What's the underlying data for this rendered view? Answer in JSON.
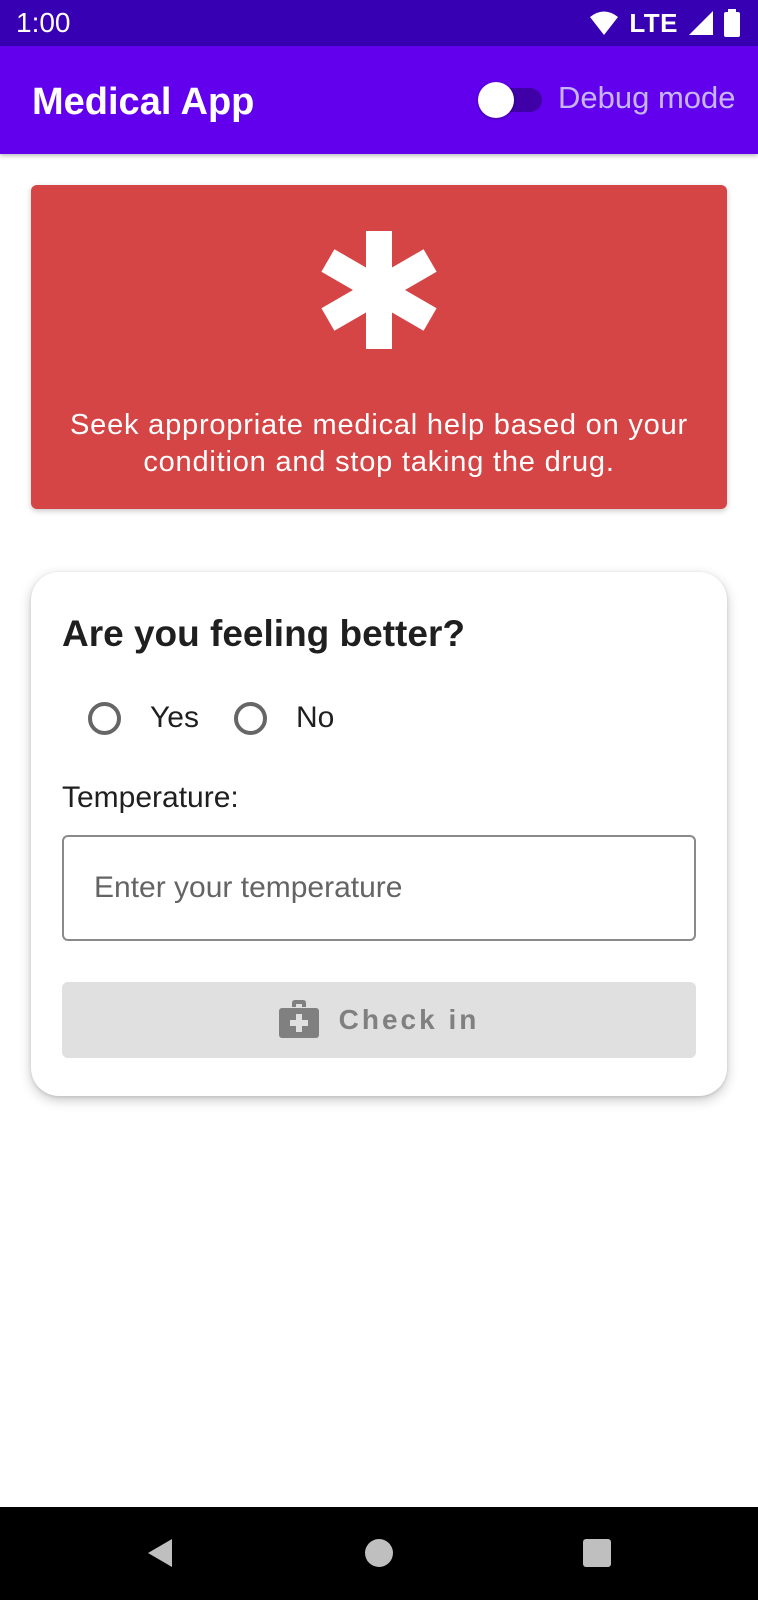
{
  "status_bar": {
    "time": "1:00",
    "network": "LTE",
    "icons": [
      "wifi-icon",
      "cell-signal-icon",
      "battery-icon"
    ]
  },
  "app_bar": {
    "title": "Medical App",
    "debug_toggle": {
      "label": "Debug mode",
      "checked": false
    },
    "color": "#6200ee"
  },
  "warning": {
    "icon": "asterisk-medical-icon",
    "message": "Seek appropriate medical help based on your condition and stop taking the drug.",
    "color": "#d64545"
  },
  "checkin": {
    "question": "Are you feeling better?",
    "options": [
      {
        "label": "Yes",
        "selected": false
      },
      {
        "label": "No",
        "selected": false
      }
    ],
    "temperature_label": "Temperature:",
    "temperature_value": "",
    "temperature_placeholder": "Enter your temperature",
    "button": {
      "label": "Check in",
      "icon": "medical-bag-icon",
      "enabled": false
    }
  },
  "nav_bar": {
    "buttons": [
      "back-icon",
      "home-icon",
      "recents-icon"
    ]
  }
}
